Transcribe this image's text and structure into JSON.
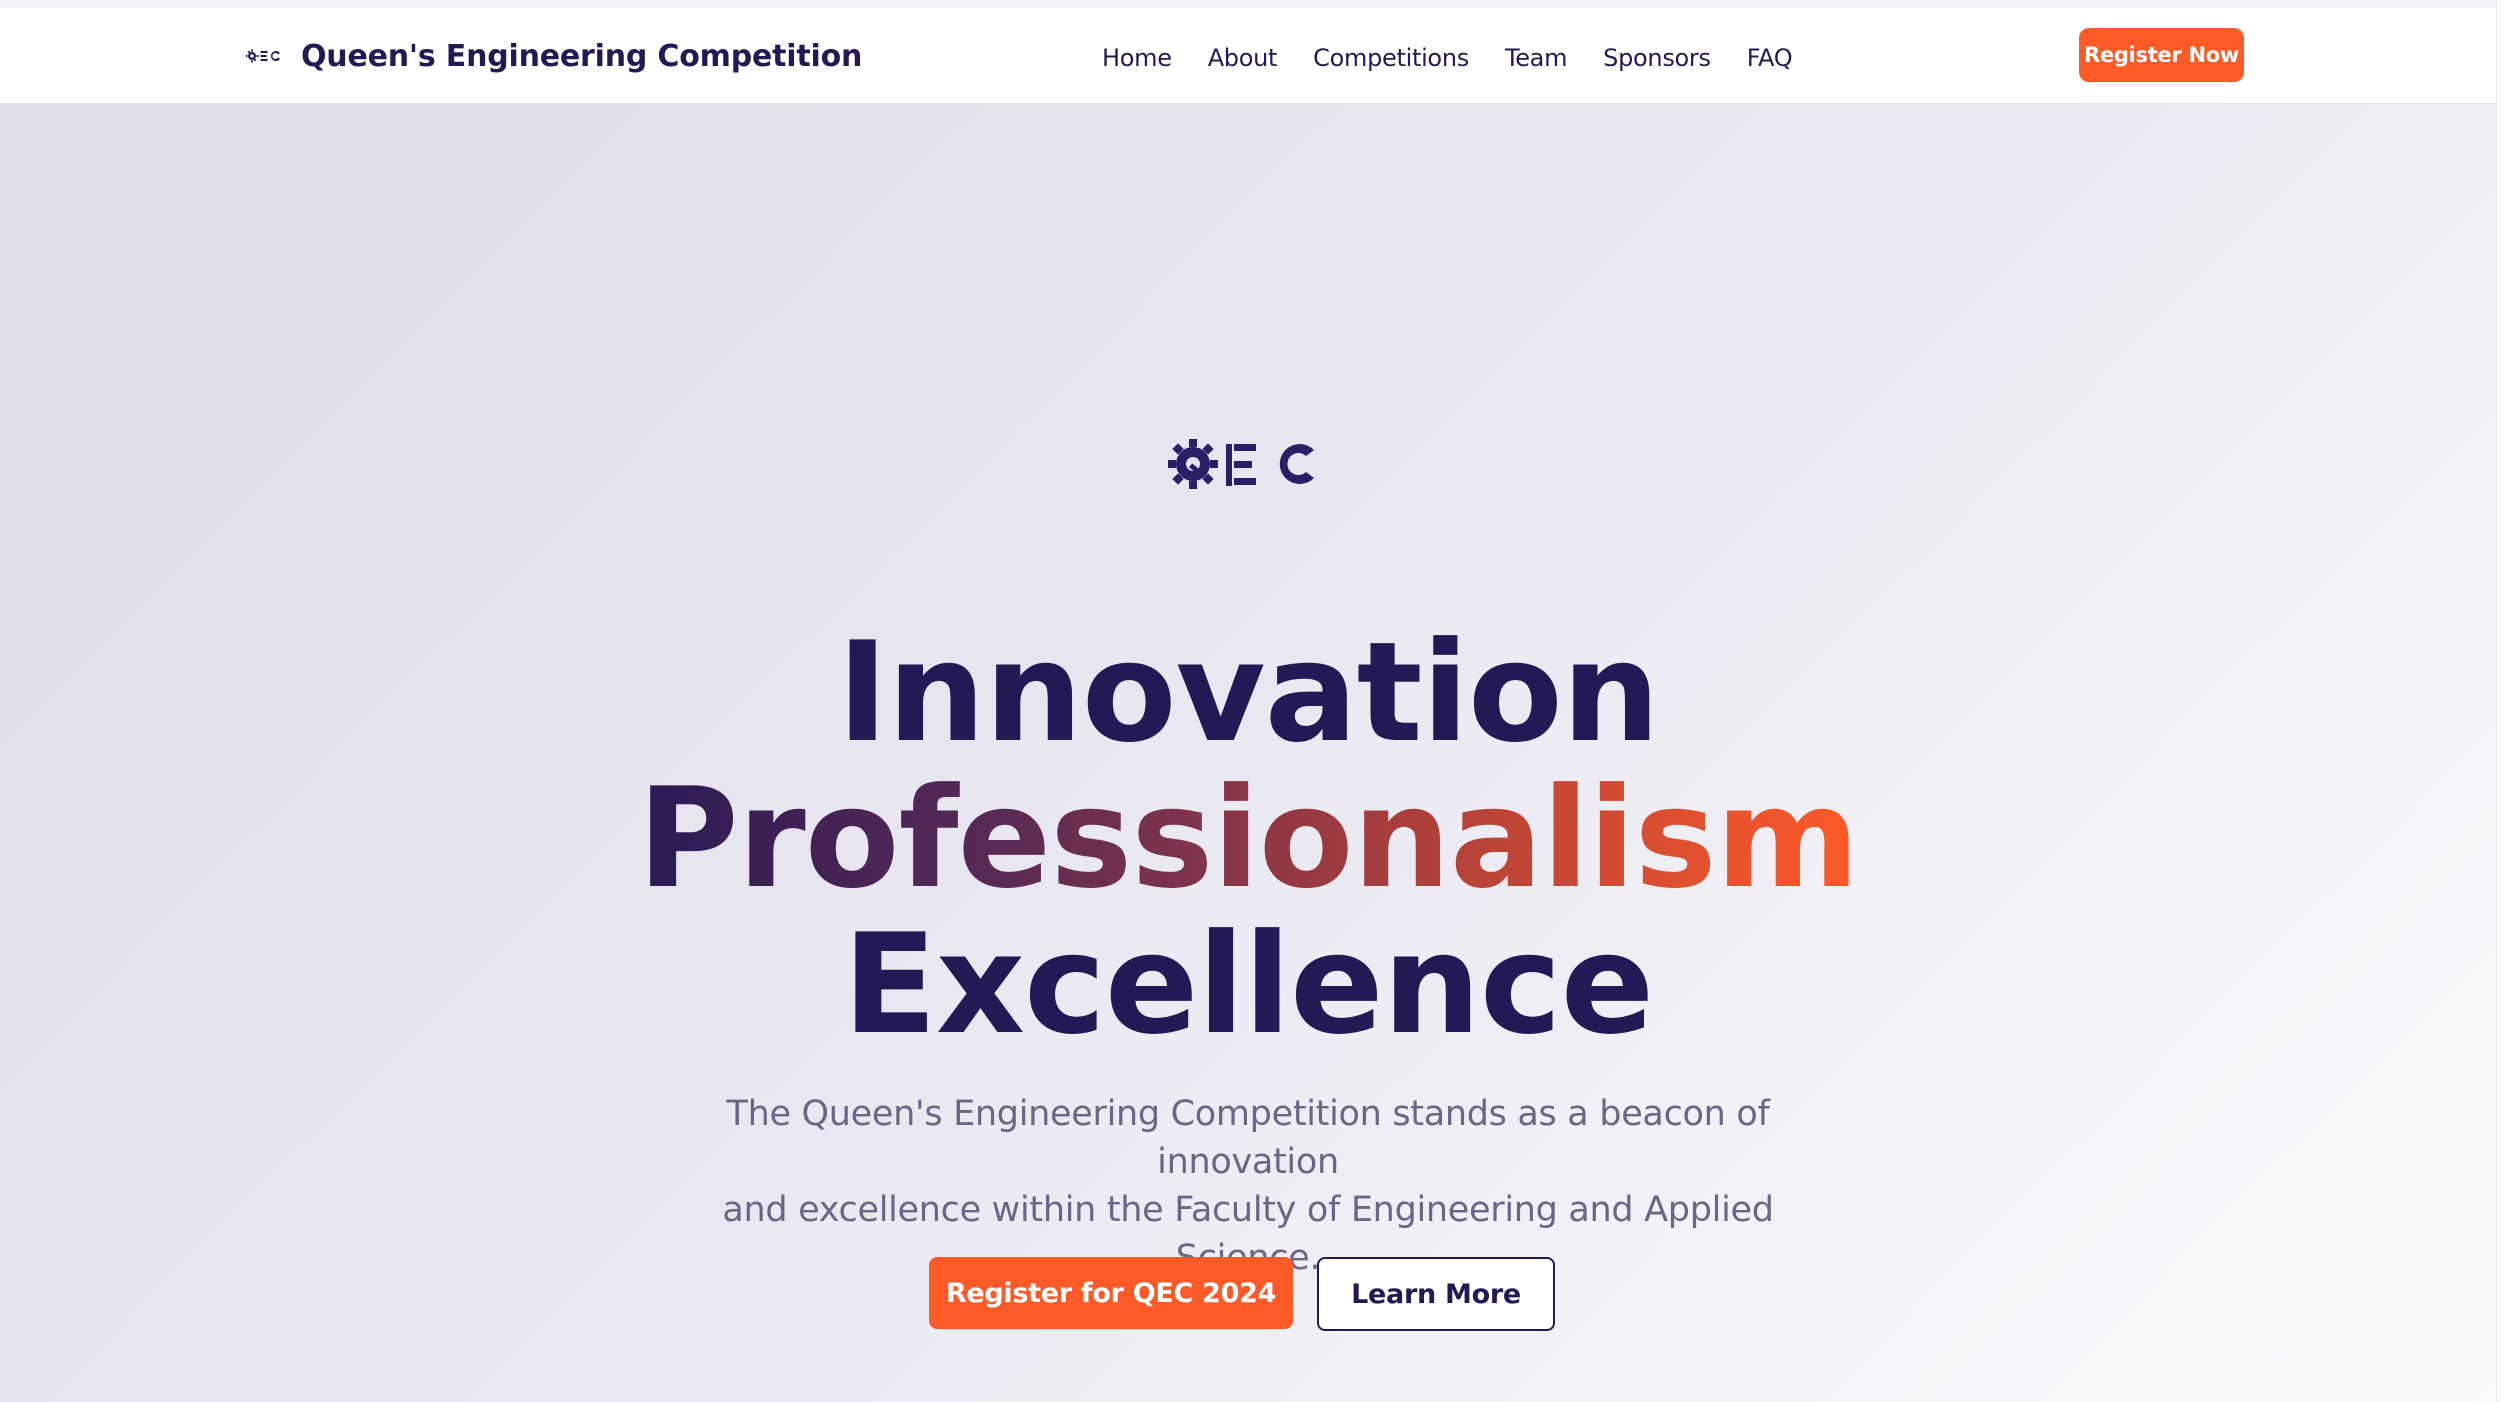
{
  "colors": {
    "brand_dark": "#221a55",
    "accent_orange": "#fd5a28",
    "muted_text": "#6a6784",
    "hero_bg_start": "#deddea",
    "hero_bg_end": "#fbfbfd"
  },
  "header": {
    "logo_text": "QEC",
    "logo_icon": "qec-gear-logo-icon",
    "title": "Queen's Engineering Competition",
    "nav": [
      {
        "label": "Home"
      },
      {
        "label": "About"
      },
      {
        "label": "Competitions"
      },
      {
        "label": "Team"
      },
      {
        "label": "Sponsors"
      },
      {
        "label": "FAQ"
      }
    ],
    "cta_label": "Register Now"
  },
  "hero": {
    "logo_text": "QEC",
    "logo_icon": "qec-gear-logo-icon",
    "headline": {
      "line1": "Innovation",
      "line2": "Professionalism",
      "line3": "Excellence"
    },
    "subtitle_line1": "The Queen's Engineering Competition stands as a beacon of innovation",
    "subtitle_line2": "and excellence within the Faculty of Engineering and Applied Science.",
    "primary_button": "Register for QEC 2024",
    "secondary_button": "Learn More"
  }
}
